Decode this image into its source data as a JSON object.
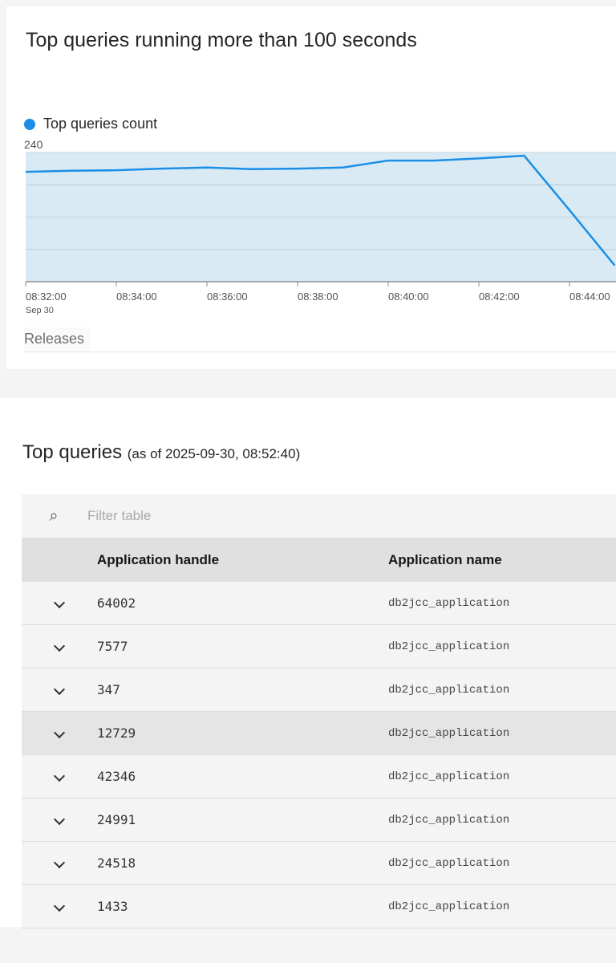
{
  "chart_panel": {
    "title": "Top queries running more than 100 seconds",
    "releases_label": "Releases"
  },
  "chart_data": {
    "type": "area",
    "title": "Top queries running more than 100 seconds",
    "legend": [
      "Top queries count"
    ],
    "legend_placement": "top-left",
    "series_color": "#1a8fe6",
    "fill_color": "#d9eaf5",
    "y_tick_labels": [
      "240"
    ],
    "ylim": [
      0,
      240
    ],
    "grid": true,
    "x_tick_labels": [
      "08:32:00",
      "08:34:00",
      "08:36:00",
      "08:38:00",
      "08:40:00",
      "08:42:00",
      "08:44:00"
    ],
    "x_date_label": "Sep 30",
    "series": [
      {
        "name": "Top queries count",
        "x": [
          "08:32",
          "08:33",
          "08:34",
          "08:35",
          "08:36",
          "08:37",
          "08:38",
          "08:39",
          "08:40",
          "08:41",
          "08:42",
          "08:43",
          "08:44",
          "08:45"
        ],
        "values": [
          204,
          206,
          207,
          210,
          212,
          209,
          210,
          212,
          225,
          225,
          229,
          234,
          133,
          30
        ]
      }
    ]
  },
  "table_panel": {
    "title": "Top queries",
    "subtitle": "(as of 2025-09-30, 08:52:40)",
    "filter_placeholder": "Filter table",
    "columns": [
      "Application handle",
      "Application name"
    ],
    "rows": [
      {
        "handle": "64002",
        "name": "db2jcc_application"
      },
      {
        "handle": "7577",
        "name": "db2jcc_application"
      },
      {
        "handle": "347",
        "name": "db2jcc_application"
      },
      {
        "handle": "12729",
        "name": "db2jcc_application"
      },
      {
        "handle": "42346",
        "name": "db2jcc_application"
      },
      {
        "handle": "24991",
        "name": "db2jcc_application"
      },
      {
        "handle": "24518",
        "name": "db2jcc_application"
      },
      {
        "handle": "1433",
        "name": "db2jcc_application"
      }
    ]
  }
}
